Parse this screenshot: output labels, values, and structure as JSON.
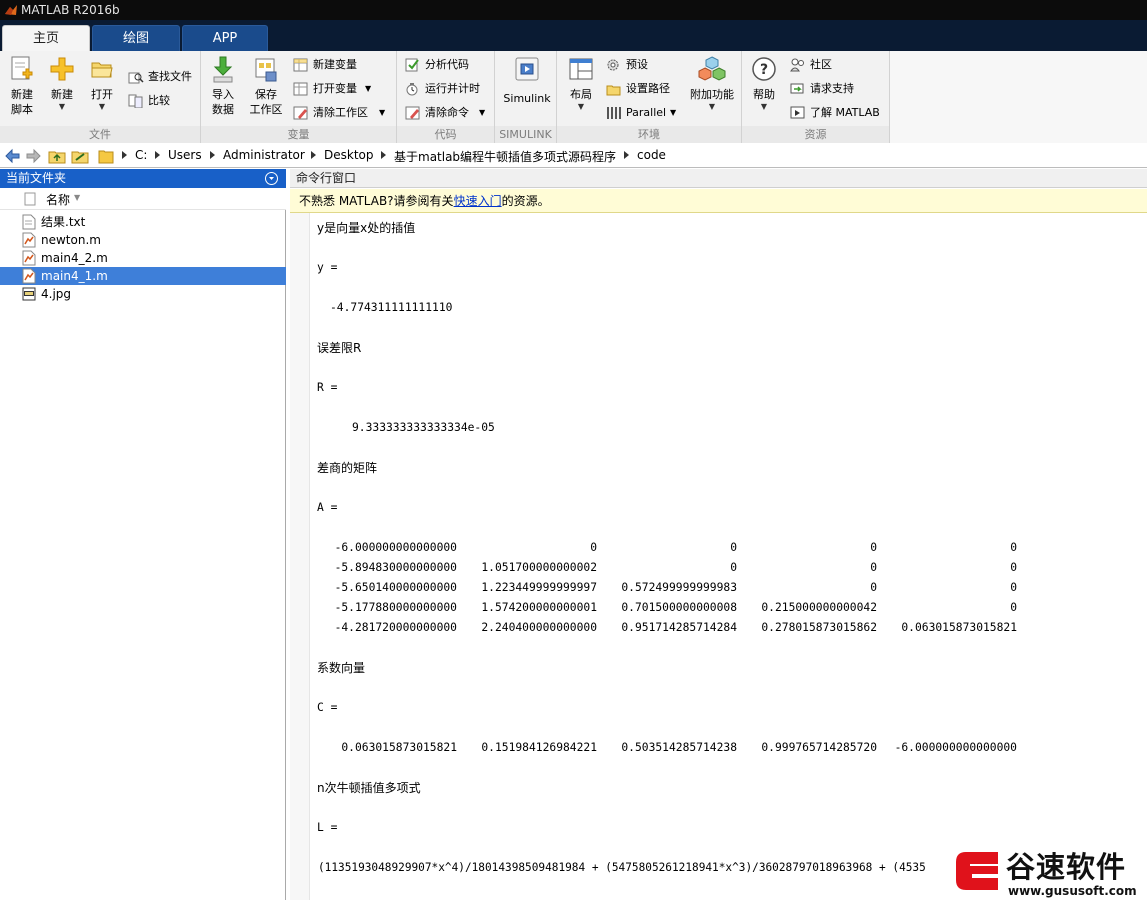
{
  "window": {
    "title": "MATLAB R2016b"
  },
  "tabs": [
    {
      "label": "主页",
      "active": true
    },
    {
      "label": "绘图",
      "active": false
    },
    {
      "label": "APP",
      "active": false
    }
  ],
  "ribbon": {
    "file": {
      "label": "文件",
      "new_script": "新建\n脚本",
      "new_script_l1": "新建",
      "new_script_l2": "脚本",
      "new": "新建",
      "open": "打开",
      "find_files": "查找文件",
      "compare": "比较"
    },
    "variable": {
      "label": "变量",
      "import_l1": "导入",
      "import_l2": "数据",
      "save_l1": "保存",
      "save_l2": "工作区",
      "new_variable": "新建变量",
      "open_variable": "打开变量",
      "clear_workspace": "清除工作区"
    },
    "code": {
      "label": "代码",
      "analyze": "分析代码",
      "run_time": "运行并计时",
      "clear_commands": "清除命令"
    },
    "simulink": {
      "label": "SIMULINK",
      "button": "Simulink"
    },
    "environment": {
      "label": "环境",
      "layout": "布局",
      "preferences": "预设",
      "set_path": "设置路径",
      "parallel": "Parallel",
      "addons": "附加功能"
    },
    "resources": {
      "label": "资源",
      "help": "帮助",
      "community": "社区",
      "support": "请求支持",
      "learn": "了解 MATLAB"
    }
  },
  "address": {
    "crumbs": [
      "C:",
      "Users",
      "Administrator",
      "Desktop",
      "基于matlab编程牛顿插值多项式源码程序",
      "code"
    ]
  },
  "current_folder": {
    "title": "当前文件夹",
    "column": "名称",
    "files": [
      {
        "name": "结果.txt",
        "type": "txt",
        "selected": false
      },
      {
        "name": "newton.m",
        "type": "m",
        "selected": false
      },
      {
        "name": "main4_2.m",
        "type": "m",
        "selected": false
      },
      {
        "name": "main4_1.m",
        "type": "m",
        "selected": true
      },
      {
        "name": "4.jpg",
        "type": "jpg",
        "selected": false
      }
    ]
  },
  "command_window": {
    "title": "命令行窗口",
    "notice_pre": "不熟悉 MATLAB?请参阅有关",
    "notice_link": "快速入门",
    "notice_post": "的资源。",
    "y_desc": "y是向量x处的插值",
    "y_label": "y =",
    "y_value": "-4.774311111111110",
    "r_desc": "误差限R",
    "r_label": "R =",
    "r_value": "9.333333333333334e-05",
    "a_desc": "差商的矩阵",
    "a_label": "A =",
    "matrix_a": [
      [
        "-6.000000000000000",
        "0",
        "0",
        "0",
        "0"
      ],
      [
        "-5.894830000000000",
        "1.051700000000002",
        "0",
        "0",
        "0"
      ],
      [
        "-5.650140000000000",
        "1.223449999999997",
        "0.572499999999983",
        "0",
        "0"
      ],
      [
        "-5.177880000000000",
        "1.574200000000001",
        "0.701500000000008",
        "0.215000000000042",
        "0"
      ],
      [
        "-4.281720000000000",
        "2.240400000000000",
        "0.951714285714284",
        "0.278015873015862",
        "0.063015873015821"
      ]
    ],
    "c_desc": "系数向量",
    "c_label": "C =",
    "vector_c": [
      "0.063015873015821",
      "0.151984126984221",
      "0.503514285714238",
      "0.999765714285720",
      "-6.000000000000000"
    ],
    "l_desc": "n次牛顿插值多项式",
    "l_label": "L =",
    "l_value": "(1135193048929907*x^4)/18014398509481984 + (5475805261218941*x^3)/36028797018963968 + (4535"
  },
  "watermark": {
    "brand": "谷速软件",
    "url": "www.gususoft.com"
  }
}
